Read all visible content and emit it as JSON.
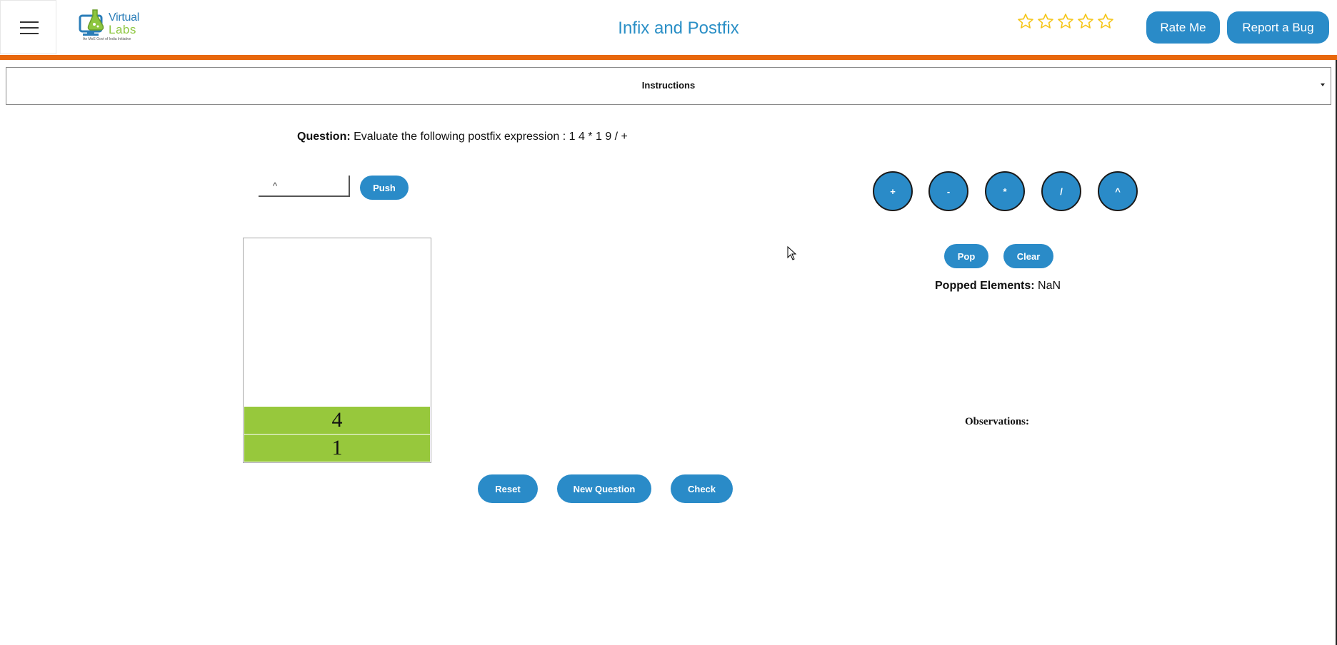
{
  "header": {
    "title": "Infix and Postfix",
    "logo": {
      "line1": "Virtual",
      "line2": "Labs",
      "tagline": "An MoE Govt of India Initiative"
    },
    "rating_stars": 5,
    "rate_me_label": "Rate Me",
    "report_bug_label": "Report a Bug"
  },
  "instructions": {
    "label": "Instructions"
  },
  "question": {
    "label": "Question:",
    "text": " Evaluate the following postfix expression : 1 4 * 1 9 / +"
  },
  "push": {
    "input_value": "^",
    "button_label": "Push"
  },
  "operators": [
    "+",
    "-",
    "*",
    "/",
    "^"
  ],
  "stack": {
    "items_top_to_bottom": [
      "4",
      "1"
    ]
  },
  "controls": {
    "pop_label": "Pop",
    "clear_label": "Clear"
  },
  "popped": {
    "label": "Popped Elements:",
    "value": " NaN"
  },
  "observations": {
    "label": "Observations:"
  },
  "footer_buttons": {
    "reset_label": "Reset",
    "new_question_label": "New Question",
    "check_label": "Check"
  },
  "colors": {
    "accent_blue": "#2a8bc8",
    "title_blue": "#2a8fc6",
    "orange_bar": "#e8670c",
    "stack_green": "#97c83c",
    "star_yellow": "#f5c518"
  }
}
